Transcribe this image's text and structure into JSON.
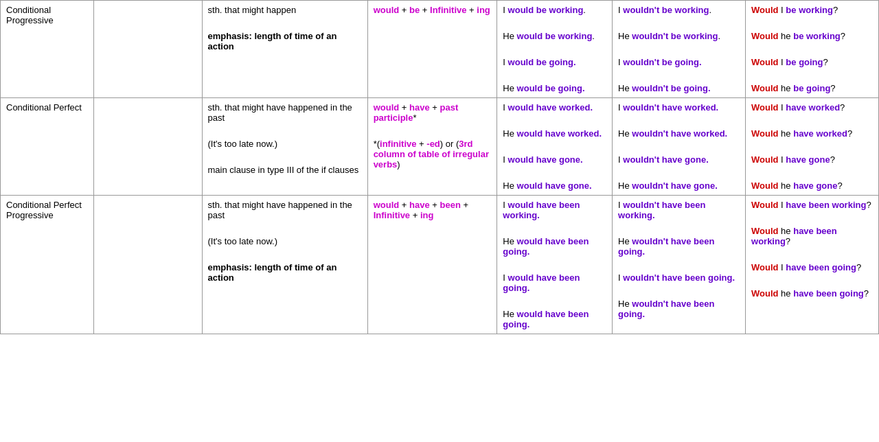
{
  "table": {
    "rows": [
      {
        "name": "Conditional Progressive",
        "extra": "",
        "description": [
          {
            "text": "sth. that might happen",
            "bold": false
          },
          {
            "text": "",
            "bold": false
          },
          {
            "text": "emphasis: length of time of an action",
            "bold": true
          }
        ],
        "formula": "would + be + Infinitive + ing",
        "affirmative": [
          "I would be working.",
          "He would be working.",
          "I would be going.",
          "He would be going."
        ],
        "negative": [
          "I wouldn't be working.",
          "He wouldn't be working.",
          "I wouldn't be going.",
          "He wouldn't be going."
        ],
        "question": [
          "Would I be working?",
          "Would he be working?",
          "Would I be going?",
          "Would he be going?"
        ]
      },
      {
        "name": "Conditional Perfect",
        "extra": "",
        "description": [
          {
            "text": "sth. that might have happened in the past",
            "bold": false
          },
          {
            "text": "",
            "bold": false
          },
          {
            "text": "(It's too late now.)",
            "bold": false
          },
          {
            "text": "",
            "bold": false
          },
          {
            "text": "main clause in type III of the if clauses",
            "bold": false
          }
        ],
        "formula": "would + have + past participle*\n*(infinitive + -ed) or (3rd column of table of irregular verbs)",
        "affirmative": [
          "I would have worked.",
          "He would have worked.",
          "I would have gone.",
          "He would have gone."
        ],
        "negative": [
          "I wouldn't have worked.",
          "He wouldn't have worked.",
          "I wouldn't have gone.",
          "He wouldn't have gone."
        ],
        "question": [
          "Would I have worked?",
          "Would he have worked?",
          "Would I have gone?",
          "Would he have gone?"
        ]
      },
      {
        "name": "Conditional Perfect Progressive",
        "extra": "",
        "description": [
          {
            "text": "sth. that might have happened in the past",
            "bold": false
          },
          {
            "text": "",
            "bold": false
          },
          {
            "text": "(It's too late now.)",
            "bold": false
          },
          {
            "text": "",
            "bold": false
          },
          {
            "text": "emphasis: length of time of an action",
            "bold": true
          }
        ],
        "formula": "would + have + been + Infinitive + ing",
        "affirmative": [
          "I would have been working.",
          "He would have been going.",
          "I would have been going.",
          "He would have been going."
        ],
        "negative": [
          "I wouldn't have been working.",
          "He wouldn't have been going.",
          "I wouldn't have been going.",
          "He wouldn't have been going."
        ],
        "question": [
          "Would I have been working?",
          "Would he have been working?",
          "Would I have been going?",
          "Would he have been going?"
        ]
      }
    ]
  }
}
